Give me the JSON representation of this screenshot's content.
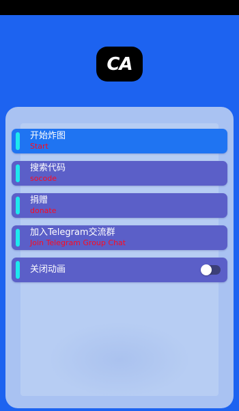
{
  "app": {
    "logo_text": "CA"
  },
  "menu": {
    "items": [
      {
        "label": "开始炸图",
        "sublabel": "Start"
      },
      {
        "label": "搜索代码",
        "sublabel": "socode"
      },
      {
        "label": "捐赠",
        "sublabel": "donate"
      },
      {
        "label": "加入Telegram交流群",
        "sublabel": "Join Telegram Group Chat"
      },
      {
        "label": "关闭动画",
        "toggle_on": false
      }
    ]
  },
  "colors": {
    "background": "#1d63f0",
    "menu_item": "#5b5fc8",
    "menu_item_active": "#1f74f2",
    "accent_bar": "#1ee8ee",
    "sublabel": "#ff0a1e"
  },
  "icons": {
    "logo": "ca-logo-icon",
    "toggle": "toggle-switch"
  }
}
